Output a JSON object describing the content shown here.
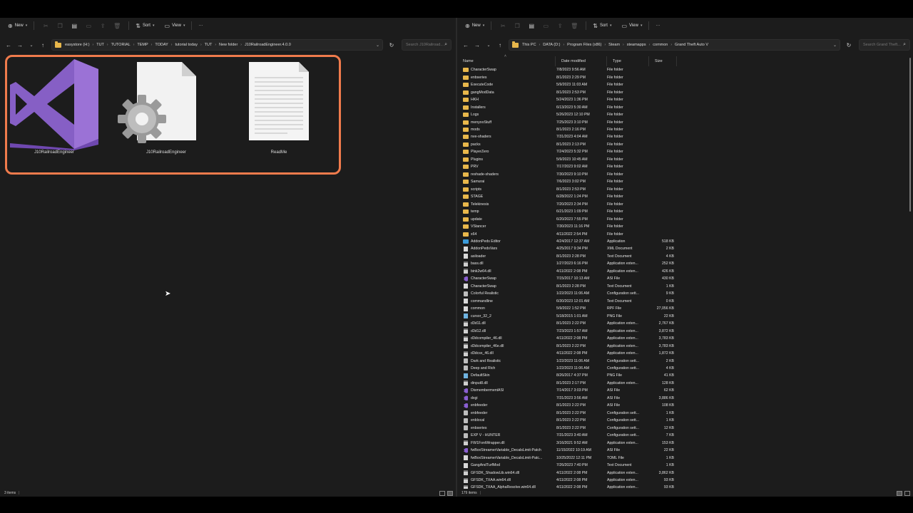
{
  "left": {
    "toolbar": {
      "new_label": "New",
      "sort_label": "Sort",
      "view_label": "View",
      "more_label": "···"
    },
    "breadcrumbs": [
      "easystore (H:)",
      "TUT",
      "TUTORIAL",
      "TEMP",
      "TODAY",
      "tutorial today",
      "TUT",
      "New folder",
      "J10RailroadEngineer.4.0.0"
    ],
    "search_placeholder": "Search J10Railroad...",
    "items": [
      {
        "name": "J10RailroadEngineer",
        "icon": "visual-studio-icon"
      },
      {
        "name": "J10RailroadEngineer",
        "icon": "settings-file-icon"
      },
      {
        "name": "ReadMe",
        "icon": "text-document-icon"
      }
    ],
    "status": "3 items"
  },
  "right": {
    "toolbar": {
      "new_label": "New",
      "sort_label": "Sort",
      "view_label": "View",
      "more_label": "···"
    },
    "breadcrumbs": [
      "This PC",
      "DATA (D:)",
      "Program Files (x86)",
      "Steam",
      "steamapps",
      "common",
      "Grand Theft Auto V"
    ],
    "search_placeholder": "Search Grand Theft...",
    "columns": {
      "name": "Name",
      "date": "Date modified",
      "type": "Type",
      "size": "Size"
    },
    "rows": [
      {
        "name": "CharacterSwap",
        "date": "7/8/2023 9:56 AM",
        "type": "File folder",
        "size": "",
        "icon": "folder"
      },
      {
        "name": "enbseries",
        "date": "8/1/2023 2:29 PM",
        "type": "File folder",
        "size": "",
        "icon": "folder"
      },
      {
        "name": "ExecuteCode",
        "date": "5/9/2023 11:03 AM",
        "type": "File folder",
        "size": "",
        "icon": "folder"
      },
      {
        "name": "gangModData",
        "date": "8/1/2023 2:53 PM",
        "type": "File folder",
        "size": "",
        "icon": "folder"
      },
      {
        "name": "HKH",
        "date": "5/24/2023 1:36 PM",
        "type": "File folder",
        "size": "",
        "icon": "folder"
      },
      {
        "name": "Installers",
        "date": "6/13/2023 5:30 AM",
        "type": "File folder",
        "size": "",
        "icon": "folder"
      },
      {
        "name": "Logs",
        "date": "5/26/2023 12:10 PM",
        "type": "File folder",
        "size": "",
        "icon": "folder"
      },
      {
        "name": "menyooStuff",
        "date": "7/25/2023 3:10 PM",
        "type": "File folder",
        "size": "",
        "icon": "folder"
      },
      {
        "name": "mods",
        "date": "8/1/2023 2:16 PM",
        "type": "File folder",
        "size": "",
        "icon": "folder"
      },
      {
        "name": "nve-shaders",
        "date": "7/31/2023 4:04 AM",
        "type": "File folder",
        "size": "",
        "icon": "folder"
      },
      {
        "name": "packs",
        "date": "8/1/2023 2:13 PM",
        "type": "File folder",
        "size": "",
        "icon": "folder"
      },
      {
        "name": "PlayerZero",
        "date": "7/24/2023 5:32 PM",
        "type": "File folder",
        "size": "",
        "icon": "folder"
      },
      {
        "name": "Plugins",
        "date": "5/9/2023 10:45 AM",
        "type": "File folder",
        "size": "",
        "icon": "folder"
      },
      {
        "name": "PRV",
        "date": "7/17/2023 9:02 AM",
        "type": "File folder",
        "size": "",
        "icon": "folder"
      },
      {
        "name": "reshade-shaders",
        "date": "7/30/2023 9:10 PM",
        "type": "File folder",
        "size": "",
        "icon": "folder"
      },
      {
        "name": "Samurai",
        "date": "7/6/2023 3:02 PM",
        "type": "File folder",
        "size": "",
        "icon": "folder"
      },
      {
        "name": "scripts",
        "date": "8/1/2023 2:53 PM",
        "type": "File folder",
        "size": "",
        "icon": "folder"
      },
      {
        "name": "STAGE",
        "date": "6/28/2022 1:24 PM",
        "type": "File folder",
        "size": "",
        "icon": "folder"
      },
      {
        "name": "Telekinesis",
        "date": "7/20/2023 2:34 PM",
        "type": "File folder",
        "size": "",
        "icon": "folder"
      },
      {
        "name": "temp",
        "date": "6/21/2023 1:09 PM",
        "type": "File folder",
        "size": "",
        "icon": "folder"
      },
      {
        "name": "update",
        "date": "6/20/2023 7:55 PM",
        "type": "File folder",
        "size": "",
        "icon": "folder"
      },
      {
        "name": "VStancer",
        "date": "7/30/2023 11:16 PM",
        "type": "File folder",
        "size": "",
        "icon": "folder"
      },
      {
        "name": "x64",
        "date": "4/11/2022 2:54 PM",
        "type": "File folder",
        "size": "",
        "icon": "folder"
      },
      {
        "name": "AddonPeds Editor",
        "date": "4/24/2017 12:37 AM",
        "type": "Application",
        "size": "518 KB",
        "icon": "app"
      },
      {
        "name": "AddonPedsVars",
        "date": "4/25/2017 9:34 PM",
        "type": "XML Document",
        "size": "2 KB",
        "icon": "doc"
      },
      {
        "name": "asiloader",
        "date": "8/1/2023 2:28 PM",
        "type": "Text Document",
        "size": "4 KB",
        "icon": "doc"
      },
      {
        "name": "bass.dll",
        "date": "1/27/2023 6:16 PM",
        "type": "Application exten...",
        "size": "252 KB",
        "icon": "dll"
      },
      {
        "name": "bink2w64.dll",
        "date": "4/11/2022 2:08 PM",
        "type": "Application exten...",
        "size": "426 KB",
        "icon": "dll"
      },
      {
        "name": "CharacterSwap",
        "date": "7/15/2017 10:13 AM",
        "type": "ASI File",
        "size": "430 KB",
        "icon": "asi"
      },
      {
        "name": "CharacterSwap",
        "date": "8/1/2023 2:28 PM",
        "type": "Text Document",
        "size": "1 KB",
        "icon": "doc"
      },
      {
        "name": "Colorful Realistic",
        "date": "1/22/2023 11:06 AM",
        "type": "Configuration sett...",
        "size": "9 KB",
        "icon": "cfg"
      },
      {
        "name": "commandline",
        "date": "6/30/2023 12:01 AM",
        "type": "Text Document",
        "size": "0 KB",
        "icon": "doc"
      },
      {
        "name": "common",
        "date": "5/9/2022 1:52 PM",
        "type": "RPF File",
        "size": "27,056 KB",
        "icon": "doc"
      },
      {
        "name": "cursor_32_2",
        "date": "5/18/2015 1:01 AM",
        "type": "PNG File",
        "size": "22 KB",
        "icon": "img"
      },
      {
        "name": "d3d11.dll",
        "date": "8/1/2023 2:22 PM",
        "type": "Application exten...",
        "size": "2,767 KB",
        "icon": "dll"
      },
      {
        "name": "d3d12.dll",
        "date": "7/23/2023 1:57 AM",
        "type": "Application exten...",
        "size": "3,872 KB",
        "icon": "dll"
      },
      {
        "name": "d3dcompiler_46.dll",
        "date": "4/11/2022 2:08 PM",
        "type": "Application exten...",
        "size": "3,783 KB",
        "icon": "dll"
      },
      {
        "name": "d3dcompiler_46e.dll",
        "date": "8/1/2023 2:22 PM",
        "type": "Application exten...",
        "size": "3,783 KB",
        "icon": "dll"
      },
      {
        "name": "d3dcsx_46.dll",
        "date": "4/11/2022 2:08 PM",
        "type": "Application exten...",
        "size": "1,872 KB",
        "icon": "dll"
      },
      {
        "name": "Dark and Realistic",
        "date": "1/22/2023 11:06 AM",
        "type": "Configuration sett...",
        "size": "2 KB",
        "icon": "cfg"
      },
      {
        "name": "Deep and Rich",
        "date": "1/22/2023 11:06 AM",
        "type": "Configuration sett...",
        "size": "4 KB",
        "icon": "cfg"
      },
      {
        "name": "DefaultSkin",
        "date": "8/26/2017 4:37 PM",
        "type": "PNG File",
        "size": "41 KB",
        "icon": "img"
      },
      {
        "name": "dinput8.dll",
        "date": "8/1/2023 2:17 PM",
        "type": "Application exten...",
        "size": "128 KB",
        "icon": "dll"
      },
      {
        "name": "DismembermentASI",
        "date": "7/14/2017 3:03 PM",
        "type": "ASI File",
        "size": "62 KB",
        "icon": "asi"
      },
      {
        "name": "dxgi",
        "date": "7/31/2023 3:56 AM",
        "type": "ASI File",
        "size": "3,886 KB",
        "icon": "asi"
      },
      {
        "name": "enbfeeder",
        "date": "8/1/2023 2:22 PM",
        "type": "ASI File",
        "size": "108 KB",
        "icon": "asi"
      },
      {
        "name": "enbfeeder",
        "date": "8/1/2023 2:22 PM",
        "type": "Configuration sett...",
        "size": "1 KB",
        "icon": "cfg"
      },
      {
        "name": "enblocal",
        "date": "8/1/2023 2:22 PM",
        "type": "Configuration sett...",
        "size": "1 KB",
        "icon": "cfg"
      },
      {
        "name": "enbseries",
        "date": "8/1/2023 2:22 PM",
        "type": "Configuration sett...",
        "size": "12 KB",
        "icon": "cfg"
      },
      {
        "name": "EXP V - HUNTER",
        "date": "7/31/2023 3:40 AM",
        "type": "Configuration sett...",
        "size": "7 KB",
        "icon": "cfg"
      },
      {
        "name": "FW1FontWrapper.dll",
        "date": "3/16/2021 9:52 AM",
        "type": "Application exten...",
        "size": "153 KB",
        "icon": "dll"
      },
      {
        "name": "fwBoxStreamerVariable_DecalsLimit-Patch",
        "date": "11/15/2022 10:19 AM",
        "type": "ASI File",
        "size": "22 KB",
        "icon": "asi"
      },
      {
        "name": "fwBoxStreamerVariable_DecalsLimit-Patc...",
        "date": "10/25/2022 12:11 PM",
        "type": "TOML File",
        "size": "1 KB",
        "icon": "doc"
      },
      {
        "name": "GangAndTurfMod",
        "date": "7/26/2023 7:40 PM",
        "type": "Text Document",
        "size": "1 KB",
        "icon": "doc"
      },
      {
        "name": "GFSDK_ShadowLib.win64.dll",
        "date": "4/11/2022 2:08 PM",
        "type": "Application exten...",
        "size": "3,862 KB",
        "icon": "dll"
      },
      {
        "name": "GFSDK_TXAA.win64.dll",
        "date": "4/11/2022 2:08 PM",
        "type": "Application exten...",
        "size": "93 KB",
        "icon": "dll"
      },
      {
        "name": "GFSDK_TXAA_AlphaResolve.win64.dll",
        "date": "4/11/2022 2:08 PM",
        "type": "Application exten...",
        "size": "93 KB",
        "icon": "dll"
      }
    ],
    "status": "179 items"
  },
  "colors": {
    "highlight": "#f07b4c",
    "folder": "#e8b74b",
    "asi": "#8a5fd1",
    "vs_purple": "#865fc5"
  }
}
